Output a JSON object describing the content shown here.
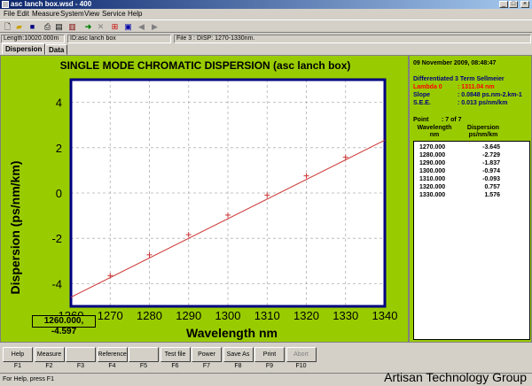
{
  "window": {
    "title": "asc lanch box.wsd - 400"
  },
  "menu": [
    "File",
    "Edit",
    "Measure",
    "System",
    "View",
    "Service",
    "Help"
  ],
  "info": {
    "length": "Length:10020.000m",
    "id": "ID:asc lanch box",
    "file": "File 3 : DISP: 1270-1330nm."
  },
  "tabs": [
    "Dispersion",
    "Data"
  ],
  "chart_data": {
    "type": "line",
    "title": "SINGLE MODE CHROMATIC DISPERSION (asc lanch box)",
    "xlabel": "Wavelength nm",
    "ylabel": "Dispersion (ps/nm/km)",
    "xlim": [
      1260,
      1340
    ],
    "ylim": [
      -5,
      5
    ],
    "xticks": [
      1260,
      1270,
      1280,
      1290,
      1300,
      1310,
      1320,
      1330,
      1340
    ],
    "yticks": [
      4,
      2,
      0,
      -2,
      -4
    ],
    "ytick_labels": [
      "4",
      "2",
      "0",
      "-2",
      "-4"
    ],
    "grid": true,
    "fit_line": {
      "x": [
        1260,
        1340
      ],
      "y": [
        -4.597,
        2.33
      ]
    },
    "points": {
      "x": [
        1270,
        1280,
        1290,
        1300,
        1310,
        1320,
        1330
      ],
      "y": [
        -3.645,
        -2.729,
        -1.837,
        -0.974,
        -0.093,
        0.757,
        1.576
      ]
    },
    "colors": {
      "background": "#99cc00",
      "plot_bg": "#ffffff",
      "frame": "#000080",
      "line": "#cc3333"
    }
  },
  "cursor_readout": "1260.000, -4.597",
  "results": {
    "date": "09 November 2009, 08:48:47",
    "method": "Differentiated 3 Term Sellmeier",
    "lambda0_label": "Lambda 0",
    "lambda0_value": ": 1311.04 nm",
    "slope_label": "Slope",
    "slope_value": ": 0.0848 ps.nm-2.km-1",
    "see_label": "S.E.E.",
    "see_value": ": 0.013 ps/nm/km",
    "point_label": "Point",
    "point_value": ": 7 of 7",
    "col1_a": "Wavelength",
    "col1_b": "nm",
    "col2_a": "Dispersion",
    "col2_b": "ps/nm/km",
    "rows": [
      [
        "1270.000",
        "-3.645"
      ],
      [
        "1280.000",
        "-2.729"
      ],
      [
        "1290.000",
        "-1.837"
      ],
      [
        "1300.000",
        "-0.974"
      ],
      [
        "1310.000",
        "-0.093"
      ],
      [
        "1320.000",
        "0.757"
      ],
      [
        "1330.000",
        "1.576"
      ]
    ]
  },
  "fkeys": [
    {
      "label": "Help",
      "key": "F1"
    },
    {
      "label": "Measure",
      "key": "F2"
    },
    {
      "label": "",
      "key": "F3"
    },
    {
      "label": "Reference",
      "key": "F4"
    },
    {
      "label": "",
      "key": "F5"
    },
    {
      "label": "Test file",
      "key": "F6"
    },
    {
      "label": "Power",
      "key": "F7"
    },
    {
      "label": "Save As",
      "key": "F8"
    },
    {
      "label": "Print",
      "key": "F9"
    },
    {
      "label": "Abort",
      "key": "F10"
    }
  ],
  "status": {
    "help": "For Help, press F1"
  },
  "watermark": "Artisan Technology Group"
}
